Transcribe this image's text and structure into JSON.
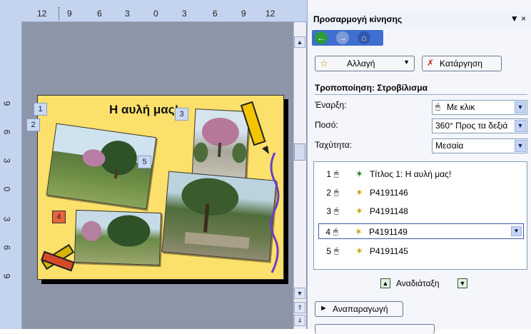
{
  "ruler": {
    "top_ticks": [
      "12",
      "9",
      "6",
      "3",
      "0",
      "3",
      "6",
      "9",
      "12"
    ],
    "left_ticks": [
      "9",
      "6",
      "3",
      "0",
      "3",
      "6",
      "9"
    ]
  },
  "slide": {
    "title": "Η αυλή μας!",
    "tags": [
      "1",
      "2",
      "3",
      "4",
      "5"
    ]
  },
  "pane": {
    "title": "Προσαρμογή κίνησης",
    "close_glyph": "▼ ×",
    "nav": {
      "back": "←",
      "forward": "→",
      "home": "⌂"
    },
    "change_button": "Αλλαγή",
    "remove_button": "Κατάργηση",
    "modify_heading": "Τροποποίηση: Στροβίλισμα",
    "start": {
      "label": "Έναρξη:",
      "value": "Με κλικ"
    },
    "amount": {
      "label": "Ποσό:",
      "value": "360° Προς τα δεξιά"
    },
    "speed": {
      "label": "Ταχύτητα:",
      "value": "Μεσαία"
    },
    "effects": [
      {
        "num": "1",
        "name": "Τίτλος 1: Η αυλή μας!"
      },
      {
        "num": "2",
        "name": "P4191146"
      },
      {
        "num": "3",
        "name": "P4191148"
      },
      {
        "num": "4",
        "name": "P4191149"
      },
      {
        "num": "5",
        "name": "P4191145"
      }
    ],
    "reorder_label": "Αναδιάταξη",
    "play_button": "Αναπαραγωγή"
  },
  "colors": {
    "slide_bg": "#fbe06b",
    "pane_bg": "#f4f6fb",
    "accent": "#3e6fd1",
    "editor_bg": "#8d95a8"
  }
}
